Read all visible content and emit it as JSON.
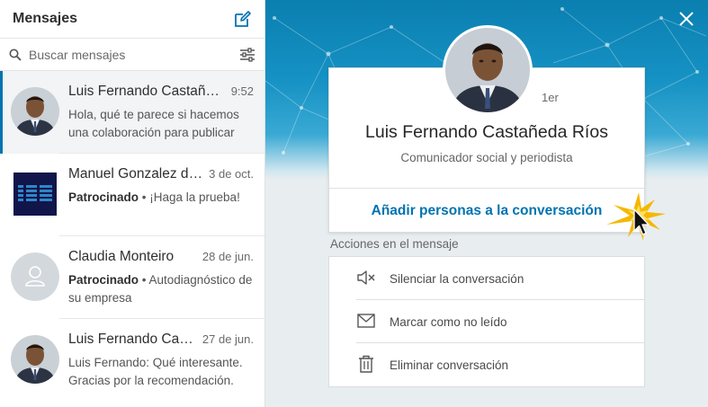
{
  "sidebar": {
    "title": "Mensajes",
    "search": {
      "placeholder": "Buscar mensajes",
      "value": ""
    },
    "conversations": [
      {
        "name": "Luis Fernando Castañeda Ríos",
        "date": "9:52",
        "sponsored": "",
        "snippet": "Hola, qué te parece si hacemos una colaboración para publicar",
        "avatar": "person-photo",
        "active": true
      },
      {
        "name": "Manuel Gonzalez de la Torre",
        "date": "3 de oct.",
        "sponsored": "Patrocinado",
        "snippet": "¡Haga la prueba!",
        "avatar": "ibm-logo",
        "active": false
      },
      {
        "name": "Claudia Monteiro",
        "date": "28 de jun.",
        "sponsored": "Patrocinado",
        "snippet": "Autodiagnóstico de su empresa",
        "avatar": "placeholder-person",
        "active": false
      },
      {
        "name": "Luis Fernando Castañeda Ríos",
        "date": "27 de jun.",
        "sponsored": "",
        "snippet": "Luis Fernando: Qué interesante. Gracias por la recomendación.",
        "avatar": "person-photo",
        "active": false
      }
    ]
  },
  "profile": {
    "degree": "1er",
    "name": "Luis Fernando Castañeda Ríos",
    "headline": "Comunicador social y periodista",
    "add_people_label": "Añadir personas a la conversación"
  },
  "actions": {
    "label": "Acciones en el mensaje",
    "items": [
      {
        "label": "Silenciar la conversación",
        "icon": "mute-icon"
      },
      {
        "label": "Marcar como no leído",
        "icon": "envelope-icon"
      },
      {
        "label": "Eliminar conversación",
        "icon": "trash-icon"
      }
    ]
  },
  "colors": {
    "accent": "#0073b1",
    "banner": "#0a7fb0",
    "burst": "#f5b800"
  }
}
